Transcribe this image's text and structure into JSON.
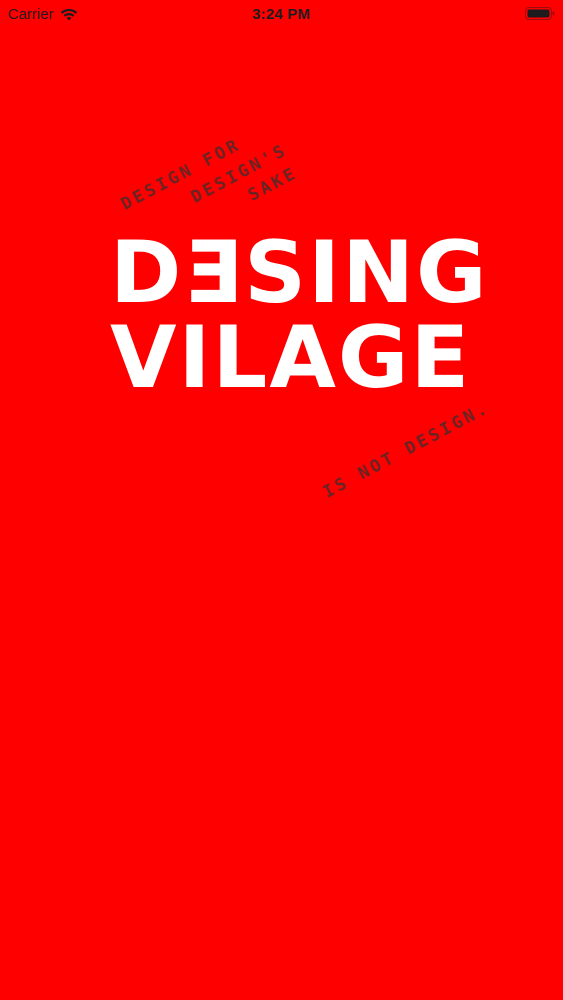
{
  "status_bar": {
    "carrier": "Carrier",
    "time": "3:24 PM",
    "icons": [
      "wifi-icon",
      "battery-icon"
    ]
  },
  "logo": {
    "line1": "DƎSING",
    "line2": "VILAGE"
  },
  "taglines": {
    "top_line1": "DESIGN FOR",
    "top_line2": "DESIGN'S",
    "top_line3": "SAKE",
    "bottom": "IS NOT DESIGN."
  },
  "colors": {
    "background": "#ff0000",
    "logo_text": "#ffffff",
    "tagline_text": "#6a2323",
    "status_text": "#1c1c1e"
  }
}
